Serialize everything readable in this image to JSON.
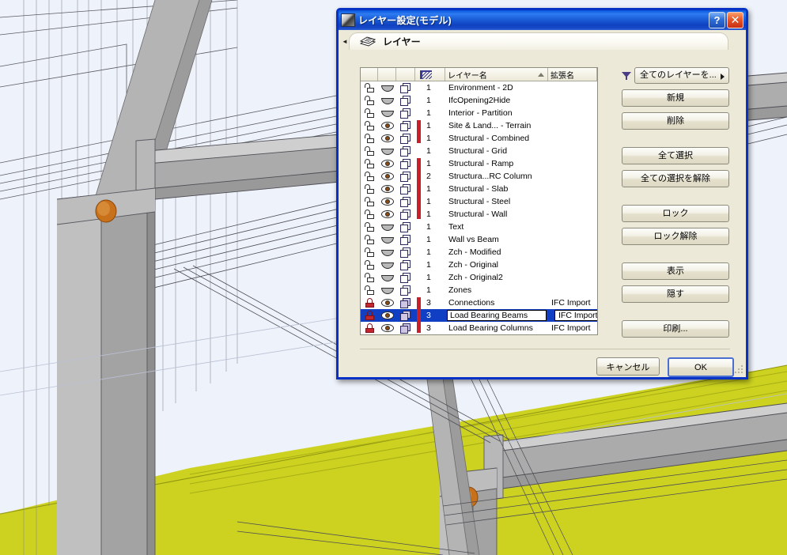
{
  "window": {
    "title": "レイヤー設定(モデル)",
    "title_icon": "archicad-layers-icon",
    "help_label": "?",
    "close_label": "✕",
    "accent_color": "#0831c6",
    "face_color": "#ece9d8"
  },
  "tab": {
    "collapse_arrow": "◄",
    "icon": "stacked-layers-icon",
    "label": "レイヤー"
  },
  "list": {
    "columns": {
      "lock": "",
      "eye": "",
      "wireframe": "",
      "pen": "",
      "name": "レイヤー名",
      "extension": "拡張名",
      "sort_indicator": "▲"
    },
    "rows": [
      {
        "lock": "unlocked",
        "eye": "closed",
        "wire": "outline",
        "bar": false,
        "pen": "1",
        "name": "Environment - 2D",
        "ext": "",
        "selected": false
      },
      {
        "lock": "unlocked",
        "eye": "closed",
        "wire": "outline",
        "bar": false,
        "pen": "1",
        "name": "IfcOpening2Hide",
        "ext": "",
        "selected": false
      },
      {
        "lock": "unlocked",
        "eye": "closed",
        "wire": "outline",
        "bar": false,
        "pen": "1",
        "name": "Interior - Partition",
        "ext": "",
        "selected": false
      },
      {
        "lock": "unlocked",
        "eye": "open",
        "wire": "outline",
        "bar": true,
        "pen": "1",
        "name": "Site & Land... - Terrain",
        "ext": "",
        "selected": false
      },
      {
        "lock": "unlocked",
        "eye": "open",
        "wire": "outline",
        "bar": true,
        "pen": "1",
        "name": "Structural - Combined",
        "ext": "",
        "selected": false
      },
      {
        "lock": "unlocked",
        "eye": "closed",
        "wire": "outline",
        "bar": false,
        "pen": "1",
        "name": "Structural - Grid",
        "ext": "",
        "selected": false
      },
      {
        "lock": "unlocked",
        "eye": "open",
        "wire": "outline",
        "bar": true,
        "pen": "1",
        "name": "Structural - Ramp",
        "ext": "",
        "selected": false
      },
      {
        "lock": "unlocked",
        "eye": "open",
        "wire": "outline",
        "bar": true,
        "pen": "2",
        "name": "Structura...RC Column",
        "ext": "",
        "selected": false
      },
      {
        "lock": "unlocked",
        "eye": "open",
        "wire": "outline",
        "bar": true,
        "pen": "1",
        "name": "Structural - Slab",
        "ext": "",
        "selected": false
      },
      {
        "lock": "unlocked",
        "eye": "open",
        "wire": "outline",
        "bar": true,
        "pen": "1",
        "name": "Structural - Steel",
        "ext": "",
        "selected": false
      },
      {
        "lock": "unlocked",
        "eye": "open",
        "wire": "outline",
        "bar": true,
        "pen": "1",
        "name": "Structural - Wall",
        "ext": "",
        "selected": false
      },
      {
        "lock": "unlocked",
        "eye": "closed",
        "wire": "outline",
        "bar": false,
        "pen": "1",
        "name": "Text",
        "ext": "",
        "selected": false
      },
      {
        "lock": "unlocked",
        "eye": "closed",
        "wire": "outline",
        "bar": false,
        "pen": "1",
        "name": "Wall vs Beam",
        "ext": "",
        "selected": false
      },
      {
        "lock": "unlocked",
        "eye": "closed",
        "wire": "outline",
        "bar": false,
        "pen": "1",
        "name": "Zch - Modified",
        "ext": "",
        "selected": false
      },
      {
        "lock": "unlocked",
        "eye": "closed",
        "wire": "outline",
        "bar": false,
        "pen": "1",
        "name": "Zch - Original",
        "ext": "",
        "selected": false
      },
      {
        "lock": "unlocked",
        "eye": "closed",
        "wire": "outline",
        "bar": false,
        "pen": "1",
        "name": "Zch - Original2",
        "ext": "",
        "selected": false
      },
      {
        "lock": "unlocked",
        "eye": "closed",
        "wire": "outline",
        "bar": false,
        "pen": "1",
        "name": "Zones",
        "ext": "",
        "selected": false
      },
      {
        "lock": "locked",
        "eye": "open",
        "wire": "filled",
        "bar": true,
        "pen": "3",
        "name": "Connections",
        "ext": "IFC Import",
        "selected": false
      },
      {
        "lock": "locked",
        "eye": "open",
        "wire": "filled",
        "bar": true,
        "pen": "3",
        "name": "Load Bearing Beams",
        "ext": "IFC Import",
        "selected": true
      },
      {
        "lock": "locked",
        "eye": "open",
        "wire": "filled",
        "bar": true,
        "pen": "3",
        "name": "Load Bearing Columns",
        "ext": "IFC Import",
        "selected": false
      }
    ],
    "scrollbar": {
      "up_label": "⌃",
      "down_label": "⌄"
    }
  },
  "actions": {
    "filter_icon": "filter-funnel-icon",
    "filter_value": "全てのレイヤーを...",
    "new": "新規",
    "delete": "削除",
    "select_all": "全て選択",
    "deselect_all": "全ての選択を解除",
    "lock": "ロック",
    "unlock": "ロック解除",
    "show": "表示",
    "hide": "隠す",
    "print": "印刷..."
  },
  "footer": {
    "cancel": "キャンセル",
    "ok": "OK"
  },
  "scene": {
    "sky_color": "#eef2fa",
    "ground_color": "#ccd21f",
    "steel_color": "#a9a9a9",
    "bolt_color": "#c9701a"
  }
}
